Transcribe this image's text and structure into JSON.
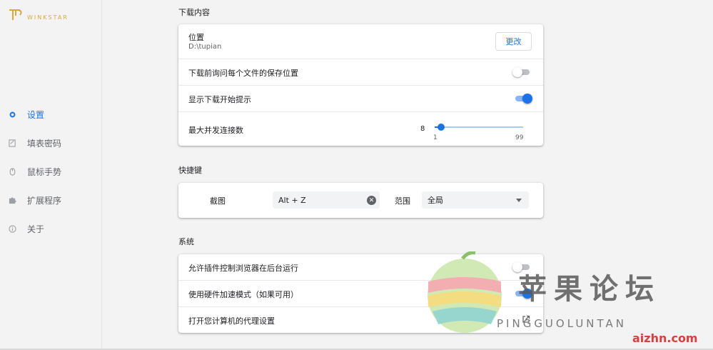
{
  "brand": {
    "name": "WINKSTAR",
    "color": "#d9a93b"
  },
  "sidebar": {
    "items": [
      {
        "label": "设置",
        "icon": "gear-icon",
        "active": true
      },
      {
        "label": "填表密码",
        "icon": "form-icon",
        "active": false
      },
      {
        "label": "鼠标手势",
        "icon": "mouse-icon",
        "active": false
      },
      {
        "label": "扩展程序",
        "icon": "puzzle-icon",
        "active": false
      },
      {
        "label": "关于",
        "icon": "info-icon",
        "active": false
      }
    ]
  },
  "downloads": {
    "section_title": "下载内容",
    "location_label": "位置",
    "location_value": "D:\\tupian",
    "change_button": "更改",
    "ask_where_label": "下载前询问每个文件的保存位置",
    "ask_where_enabled": false,
    "show_tip_label": "显示下载开始提示",
    "show_tip_enabled": true,
    "max_connections_label": "最大并发连接数",
    "max_connections_value": "8",
    "slider_min": "1",
    "slider_max": "99",
    "slider_level": 8
  },
  "shortcuts": {
    "section_title": "快捷键",
    "screenshot_label": "截图",
    "screenshot_value": "Alt + Z",
    "scope_label": "范围",
    "scope_value": "全局"
  },
  "system": {
    "section_title": "系统",
    "background_label": "允许插件控制浏览器在后台运行",
    "background_enabled": false,
    "hw_accel_label": "使用硬件加速模式（如果可用）",
    "hw_accel_enabled": true,
    "proxy_label": "打开您计算机的代理设置"
  },
  "watermark": {
    "cn": "苹果论坛",
    "en": "PINGGUOLUNTAN",
    "url": "aizhn.com"
  },
  "colors": {
    "accent": "#1a73e8",
    "background": "#f3f3f3"
  }
}
